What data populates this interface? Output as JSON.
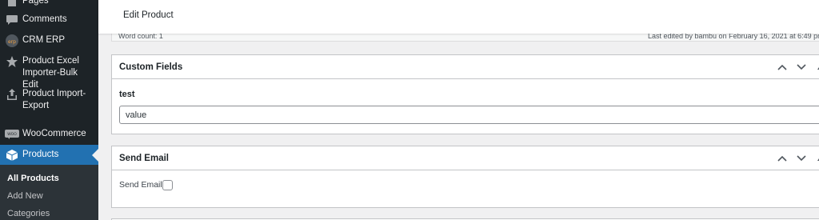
{
  "sidebar": {
    "pages_label": "Pages",
    "comments_label": "Comments",
    "crm_label": "CRM ERP",
    "excel_label": "Product Excel Importer-Bulk Edit",
    "import_label": "Product Import-Export",
    "woo_label": "WooCommerce",
    "woo_icon_text": "WOO",
    "products_label": "Products",
    "submenu": [
      "All Products",
      "Add New",
      "Categories"
    ]
  },
  "topbar": {
    "title": "Edit Product"
  },
  "status": {
    "word_count": "Word count: 1",
    "last_edited": "Last edited by bambu on February 16, 2021 at 6:49 pm"
  },
  "custom_fields": {
    "title": "Custom Fields",
    "field_label": "test",
    "field_value": "value"
  },
  "send_email": {
    "title": "Send Email",
    "checkbox_label": "Send Email"
  },
  "colors": {
    "sidebar_bg": "#1d2327",
    "active_bg": "#2271b1",
    "page_bg": "#f0f0f1"
  }
}
